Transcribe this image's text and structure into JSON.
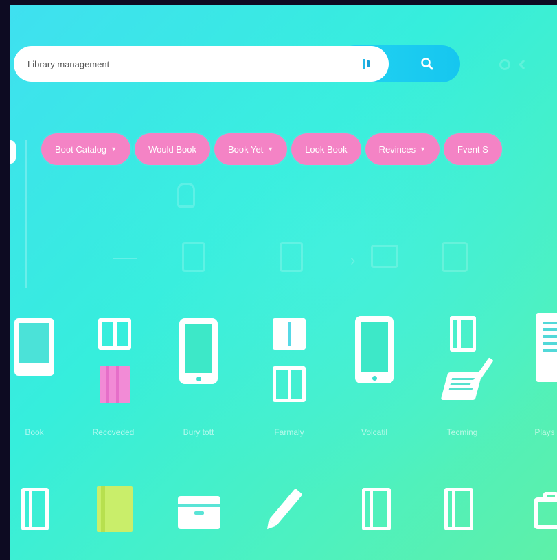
{
  "search": {
    "value": "Library management",
    "placeholder": ""
  },
  "filters": [
    {
      "label": "Boot Catalog",
      "has_dropdown": true
    },
    {
      "label": "Would Book",
      "has_dropdown": false
    },
    {
      "label": "Book Yet",
      "has_dropdown": true
    },
    {
      "label": "Look Book",
      "has_dropdown": false
    },
    {
      "label": "Revinces",
      "has_dropdown": true
    },
    {
      "label": "Fvent S",
      "has_dropdown": false
    }
  ],
  "grid_labels": [
    "Book",
    "Recoveded",
    "Bury tott",
    "Farmaly",
    "Volcatil",
    "Tecming",
    "Plays"
  ],
  "colors": {
    "accent_pink": "#f483c5",
    "search_button": "#1fcdf0",
    "folder_pink": "#f28bd6",
    "folder_yellow": "#c9ee6a"
  }
}
